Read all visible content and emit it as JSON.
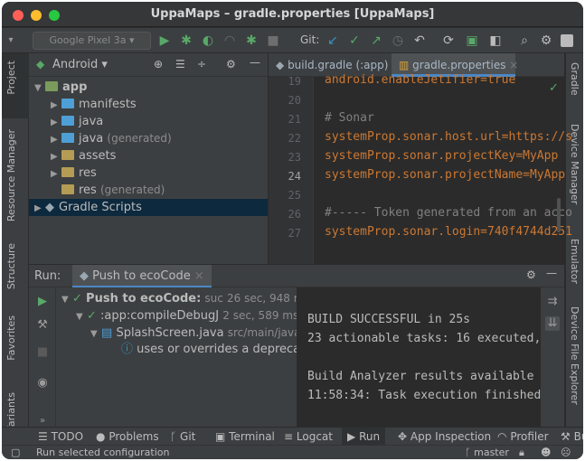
{
  "window": {
    "title": "UppaMaps – gradle.properties [UppaMaps]"
  },
  "toolbar": {
    "device": "Google Pixel 3a",
    "git_label": "Git:"
  },
  "left_sidebar": {
    "tabs": [
      "Project",
      "Resource Manager",
      "Structure",
      "Favorites",
      "Variants"
    ]
  },
  "right_sidebar": {
    "tabs": [
      "Gradle",
      "Device Manager",
      "Emulator",
      "Device File Explorer"
    ]
  },
  "project": {
    "view": "Android",
    "tree": [
      {
        "label": "app",
        "suffix": "",
        "bold": true
      },
      {
        "label": "manifests",
        "suffix": ""
      },
      {
        "label": "java",
        "suffix": ""
      },
      {
        "label": "java",
        "suffix": "(generated)"
      },
      {
        "label": "assets",
        "suffix": ""
      },
      {
        "label": "res",
        "suffix": ""
      },
      {
        "label": "res",
        "suffix": "(generated)"
      },
      {
        "label": "Gradle Scripts",
        "suffix": ""
      }
    ]
  },
  "editor": {
    "tabs": [
      {
        "label": "build.gradle (:app)",
        "active": false
      },
      {
        "label": "gradle.properties",
        "active": true
      }
    ],
    "lines": [
      {
        "n": "19",
        "text": "android.enableJetifier=true",
        "kind": "kw"
      },
      {
        "n": "20",
        "text": "",
        "kind": ""
      },
      {
        "n": "21",
        "text": "# Sonar",
        "kind": "comment"
      },
      {
        "n": "22",
        "text": "systemProp.sonar.host.url=https://s",
        "kind": "prop"
      },
      {
        "n": "23",
        "text": "systemProp.sonar.projectKey=MyApp",
        "kind": "prop"
      },
      {
        "n": "24",
        "text": "systemProp.sonar.projectName=MyApp",
        "kind": "prop"
      },
      {
        "n": "25",
        "text": "",
        "kind": ""
      },
      {
        "n": "26",
        "text": "#----- Token generated from an acco",
        "kind": "comment"
      },
      {
        "n": "27",
        "text": "systemProp.sonar.login=740f4744d251",
        "kind": "prop"
      }
    ]
  },
  "run": {
    "label": "Run:",
    "config": "Push to ecoCode",
    "tree": [
      {
        "label": "Push to ecoCode:",
        "extra": "suc",
        "time": "26 sec, 948 ms"
      },
      {
        "label": ":app:compileDebugJ",
        "extra": "",
        "time": "2 sec, 589 ms"
      },
      {
        "label": "SplashScreen.java",
        "extra": "src/main/java",
        "time": ""
      },
      {
        "label": "uses or overrides a deprecate",
        "extra": "",
        "time": ""
      }
    ],
    "console": [
      "BUILD SUCCESSFUL in 25s",
      "23 actionable tasks: 16 executed,",
      "",
      "Build Analyzer results available",
      "11:58:34: Task execution finished"
    ]
  },
  "bottom_tabs": [
    "TODO",
    "Problems",
    "Git",
    "Terminal",
    "Logcat",
    "Run",
    "App Inspection",
    "Profiler",
    "Bu"
  ],
  "status": {
    "message": "Run selected configuration",
    "branch": "master"
  },
  "colors": {
    "accent_green": "#59a869",
    "prop": "#cc7832",
    "value": "#6a8759",
    "comment": "#808080"
  }
}
